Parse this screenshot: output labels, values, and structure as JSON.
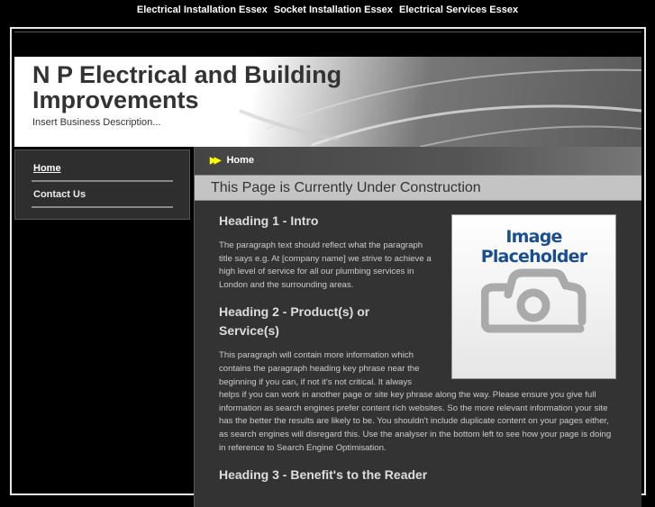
{
  "top_links": [
    "Electrical Installation Essex",
    "Socket Installation Essex",
    "Electrical Services Essex"
  ],
  "header": {
    "title": "N P Electrical and Building Improvements",
    "description": "Insert Business Description..."
  },
  "sidebar": {
    "items": [
      {
        "label": "Home"
      },
      {
        "label": "Contact Us"
      }
    ]
  },
  "breadcrumb": "Home",
  "page_title": "This Page is Currently Under Construction",
  "placeholder_label": "Image Placeholder",
  "sections": [
    {
      "heading": "Heading 1 - Intro",
      "text": "The paragraph text should reflect what the paragraph title says e.g. At [company name] we strive to achieve a high level of service for all our plumbing services in London and the surrounding areas."
    },
    {
      "heading": "Heading 2 - Product(s) or Service(s)",
      "text": "This paragraph will contain more information which contains the paragraph heading key phrase near the beginning if you can, if not it's not critical. It always helps if you can work in another page or site key phrase along the way. Please ensure you give full information as search engines prefer content rich websites. So the more relevant information your site has the better the results are likely to be. You shouldn't include duplicate content on your pages either, as search engines will disregard this. Use the analyser in the bottom left to see how your page is doing in reference to Search Engine Optimisation."
    },
    {
      "heading": "Heading 3 - Benefit's to the Reader"
    }
  ]
}
